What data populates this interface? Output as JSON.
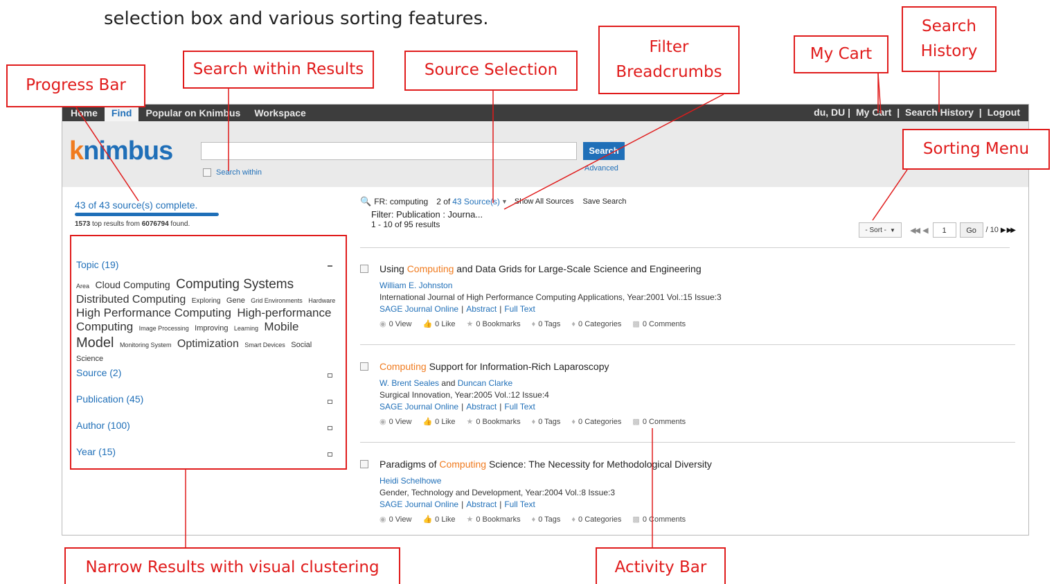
{
  "caption": "selection box and various sorting features.",
  "callouts": {
    "progress_bar": "Progress Bar",
    "search_within": "Search within Results",
    "source_selection": "Source Selection",
    "filter_breadcrumbs": "Filter Breadcrumbs",
    "my_cart": "My Cart",
    "search_history": "Search History",
    "sorting_menu": "Sorting Menu",
    "narrow_results": "Narrow Results with visual clustering",
    "activity_bar": "Activity Bar"
  },
  "navbar": {
    "items": [
      "Home",
      "Find",
      "Popular on Knimbus",
      "Workspace"
    ],
    "active": "Find",
    "user": "du, DU |",
    "my_cart": "My Cart",
    "sep1": "|",
    "search_history": "Search History",
    "sep2": "|",
    "logout": "Logout"
  },
  "header": {
    "logo": "nimbus",
    "logo_k": "k",
    "search_value": "",
    "search_button": "Search",
    "advanced": "Advanced",
    "search_within": "Search within"
  },
  "progress": {
    "label": "43 of 43 source(s) complete.",
    "fraction": 1.0,
    "found_top": "1573",
    "found_mid": " top results from ",
    "found_total": "6076794",
    "found_end": " found."
  },
  "facets": [
    {
      "label": "Topic (19)",
      "expanded": true
    },
    {
      "label": "Source (2)",
      "expanded": false
    },
    {
      "label": "Publication (45)",
      "expanded": false
    },
    {
      "label": "Author (100)",
      "expanded": false
    },
    {
      "label": "Year (15)",
      "expanded": false
    }
  ],
  "tag_cloud": [
    {
      "text": "Area",
      "size": 9
    },
    {
      "text": "Cloud Computing",
      "size": 14
    },
    {
      "text": "Computing Systems",
      "size": 19
    },
    {
      "text": "Distributed Computing",
      "size": 16
    },
    {
      "text": "Exploring",
      "size": 10
    },
    {
      "text": "Gene",
      "size": 11
    },
    {
      "text": "Grid Environments",
      "size": 9
    },
    {
      "text": "Hardware",
      "size": 9
    },
    {
      "text": "High Performance Computing",
      "size": 17
    },
    {
      "text": "High-performance Computing",
      "size": 17
    },
    {
      "text": "Image Processing",
      "size": 9
    },
    {
      "text": "Improving",
      "size": 11
    },
    {
      "text": "Learning",
      "size": 9
    },
    {
      "text": "Mobile",
      "size": 17
    },
    {
      "text": "Model",
      "size": 20
    },
    {
      "text": "Monitoring System",
      "size": 9
    },
    {
      "text": "Optimization",
      "size": 16
    },
    {
      "text": "Smart Devices",
      "size": 9
    },
    {
      "text": "Social Science",
      "size": 11
    }
  ],
  "results_header": {
    "query": "FR: computing",
    "sources_prefix": "2 of",
    "sources_link": "43 Source(s)",
    "show_all": "Show All Sources",
    "save_search": "Save Search",
    "filter": "Filter: Publication : Journa...",
    "count": "1 - 10 of 95 results"
  },
  "sorting": {
    "sort_label": "- Sort -",
    "page": "1",
    "go": "Go",
    "of_pages": "/ 10"
  },
  "results": [
    {
      "title_pre": "Using ",
      "title_hl": "Computing",
      "title_post": " and Data Grids for Large-Scale Science and Engineering",
      "authors": [
        "William E. Johnston"
      ],
      "pub": "International Journal of High Performance Computing Applications, Year:2001 Vol.:15 Issue:3",
      "links": [
        "SAGE Journal Online",
        "Abstract",
        "Full Text"
      ]
    },
    {
      "title_pre": "",
      "title_hl": "Computing",
      "title_post": " Support for Information-Rich Laparoscopy",
      "authors": [
        "W. Brent Seales",
        "Duncan Clarke"
      ],
      "pub": "Surgical Innovation, Year:2005 Vol.:12 Issue:4",
      "links": [
        "SAGE Journal Online",
        "Abstract",
        "Full Text"
      ]
    },
    {
      "title_pre": "Paradigms of ",
      "title_hl": "Computing",
      "title_post": " Science: The Necessity for Methodological Diversity",
      "authors": [
        "Heidi Schelhowe"
      ],
      "pub": "Gender, Technology and Development, Year:2004 Vol.:8 Issue:3",
      "links": [
        "SAGE Journal Online",
        "Abstract",
        "Full Text"
      ]
    }
  ],
  "activity": [
    "0 View",
    "0 Like",
    "0 Bookmarks",
    "0 Tags",
    "0 Categories",
    "0 Comments"
  ],
  "author_joiner": "and",
  "link_sep": "|",
  "colors": {
    "accent": "#1f6fb8",
    "highlight": "#f07b1f",
    "callout": "#e01b1b",
    "navbar": "#3d3d3d"
  }
}
